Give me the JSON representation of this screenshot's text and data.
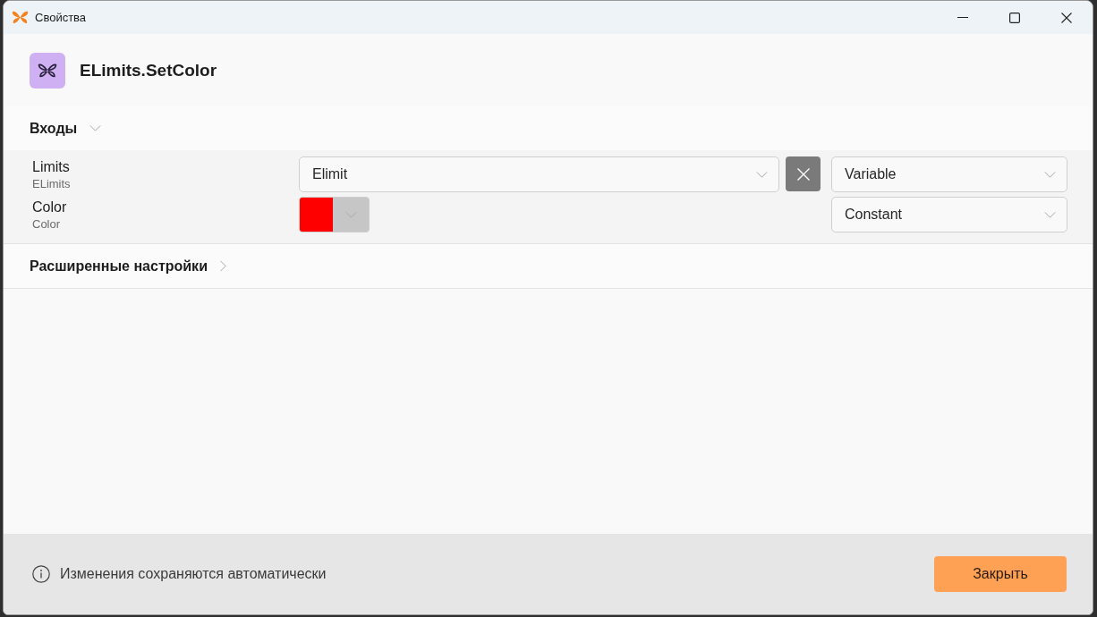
{
  "window": {
    "title": "Свойства"
  },
  "header": {
    "title": "ELimits.SetColor"
  },
  "sections": [
    {
      "title": "Входы",
      "expanded": true,
      "inputs": [
        {
          "kind": "object",
          "label": "Limits",
          "type": "ELimits",
          "value": "Elimit",
          "source": "Variable"
        },
        {
          "kind": "color",
          "label": "Color",
          "type": "Color",
          "color": "#ff0000",
          "source": "Constant"
        }
      ]
    },
    {
      "title": "Расширенные настройки",
      "expanded": false
    }
  ],
  "footer": {
    "note": "Изменения сохраняются автоматически",
    "close_button": "Закрыть"
  }
}
